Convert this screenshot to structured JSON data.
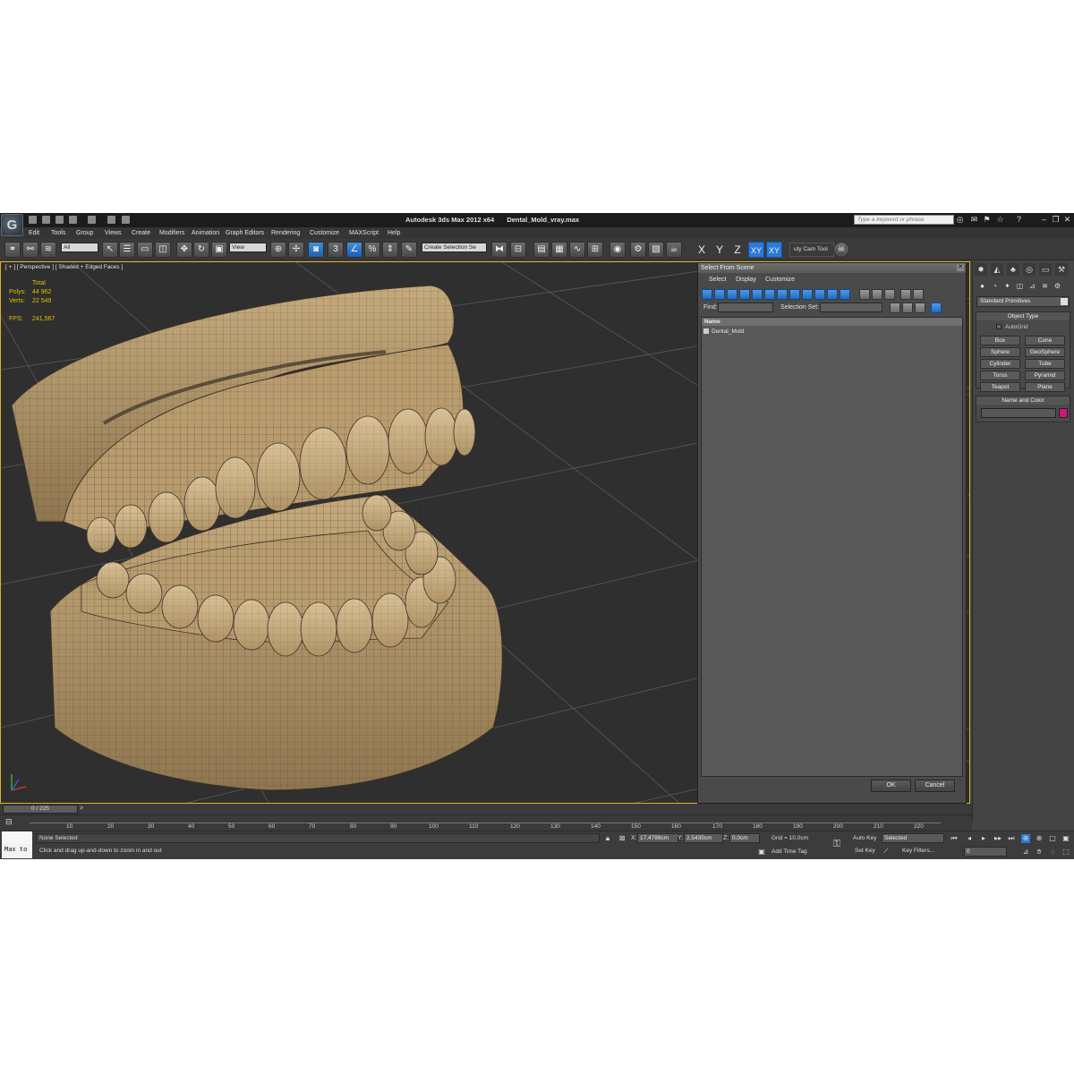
{
  "window": {
    "app_title": "Autodesk 3ds Max  2012 x64",
    "file_title": "Dental_Mold_vray.max",
    "search_placeholder": "Type a keyword or phrase"
  },
  "menu": [
    "Edit",
    "Tools",
    "Group",
    "Views",
    "Create",
    "Modifiers",
    "Animation",
    "Graph Editors",
    "Rendering",
    "Customize",
    "MAXScript",
    "Help"
  ],
  "toolbar": {
    "filter_value": "All",
    "refcoord_value": "View",
    "snap_value": "3",
    "selection_set": "Create Selection Se",
    "axes": [
      "X",
      "Y",
      "Z",
      "XY",
      "XY"
    ],
    "camera_tool": "uty Cam Tool"
  },
  "viewport": {
    "label": "[ + ] [ Perspective ] [ Shaded + Edged Faces ]",
    "stats": {
      "total_label": "Total",
      "polys_label": "Polys:",
      "polys_value": "44 962",
      "verts_label": "Verts:",
      "verts_value": "22 549",
      "fps_label": "FPS:",
      "fps_value": "241,567"
    }
  },
  "dialog": {
    "title": "Select From Scene",
    "menus": [
      "Select",
      "Display",
      "Customize"
    ],
    "find_label": "Find:",
    "selection_set_label": "Selection Set:",
    "column_name": "Name",
    "items": [
      "Dental_Mold"
    ],
    "ok_label": "OK",
    "cancel_label": "Cancel"
  },
  "command_panel": {
    "dropdown": "Standard Primitives",
    "object_type_title": "Object Type",
    "autogrid_label": "AutoGrid",
    "primitives": [
      "Box",
      "Cone",
      "Sphere",
      "GeoSphere",
      "Cylinder",
      "Tube",
      "Torus",
      "Pyramid",
      "Teapot",
      "Plane"
    ],
    "name_color_title": "Name and Color",
    "color": "#d0157e"
  },
  "timeline": {
    "frame_display": "0 / 225",
    "next_symbol": ">",
    "ticks": [
      "10",
      "20",
      "30",
      "40",
      "50",
      "60",
      "70",
      "80",
      "90",
      "100",
      "110",
      "120",
      "130",
      "140",
      "150",
      "160",
      "170",
      "180",
      "190",
      "200",
      "210",
      "220"
    ]
  },
  "status": {
    "maxscript_text": "Max to",
    "selection": "None Selected",
    "prompt": "Click and drag up-and-down to zoom in and out",
    "x_label": "X:",
    "x_value": "17,4799cm",
    "y_label": "Y:",
    "y_value": "2,5435cm",
    "z_label": "Z:",
    "z_value": "0,0cm",
    "grid": "Grid = 10,0cm",
    "add_time_tag": "Add Time Tag",
    "auto_key": "Auto Key",
    "selected": "Selected",
    "set_key": "Set Key",
    "key_filters": "Key Filters...",
    "frame_value": "0"
  }
}
